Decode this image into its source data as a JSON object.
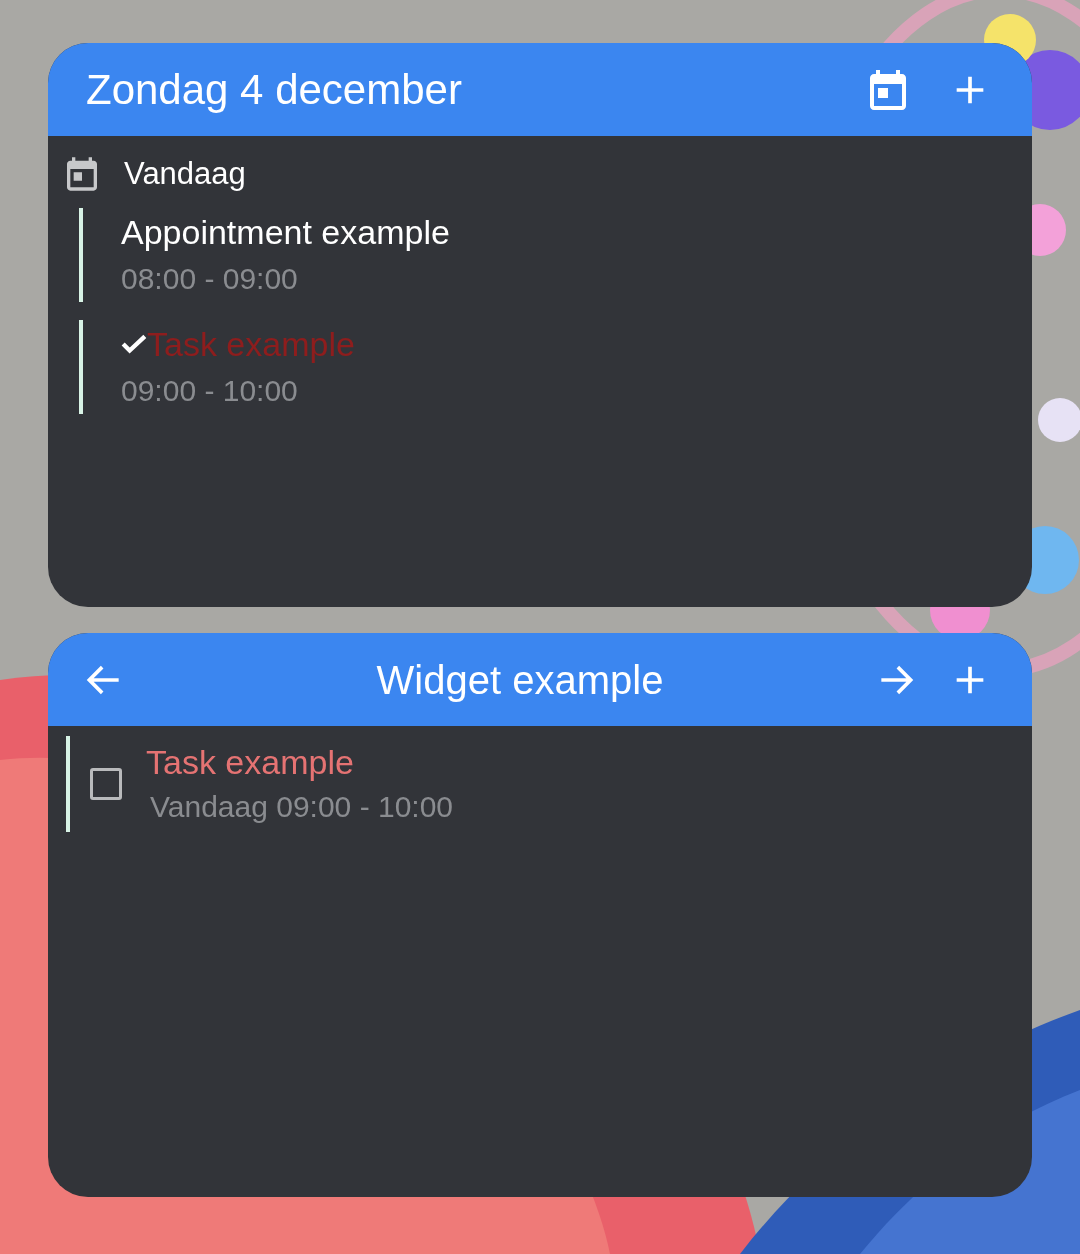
{
  "agenda_widget": {
    "title": "Zondag 4 december",
    "day_header": "Vandaag",
    "items": [
      {
        "kind": "appointment",
        "title": "Appointment example",
        "time": "08:00 - 09:00"
      },
      {
        "kind": "task",
        "title": "Task example",
        "time": "09:00 - 10:00",
        "done": true
      }
    ]
  },
  "list_widget": {
    "title": "Widget example",
    "items": [
      {
        "title": "Task example",
        "time": "Vandaag 09:00 - 10:00",
        "checked": false
      }
    ]
  }
}
